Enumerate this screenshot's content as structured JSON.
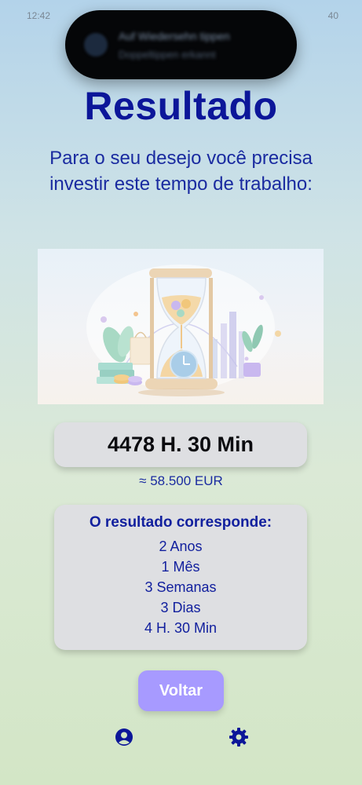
{
  "status_bar": {
    "time": "12:42",
    "battery": "40"
  },
  "notification": {
    "title": "Auf Wiedersehn tippen",
    "subtitle": "Doppeltippen erkannt"
  },
  "page": {
    "title": "Resultado",
    "subtitle": "Para o seu desejo você precisa investir este tempo de trabalho:"
  },
  "result": {
    "hours": "4478 H. 30 Min",
    "approx": "≈ 58.500 EUR",
    "breakdown_title": "O resultado corresponde:",
    "breakdown": [
      "2 Anos",
      "1 Mês",
      "3 Semanas",
      "3 Dias",
      "4 H. 30 Min"
    ]
  },
  "actions": {
    "back_label": "Voltar"
  },
  "icons": {
    "hero": "hourglass-illustration",
    "profile": "user-circle-icon",
    "settings": "gear-icon"
  },
  "colors": {
    "primary_text": "#0c1699",
    "button": "#a79aff",
    "card": "#dedfe2"
  }
}
